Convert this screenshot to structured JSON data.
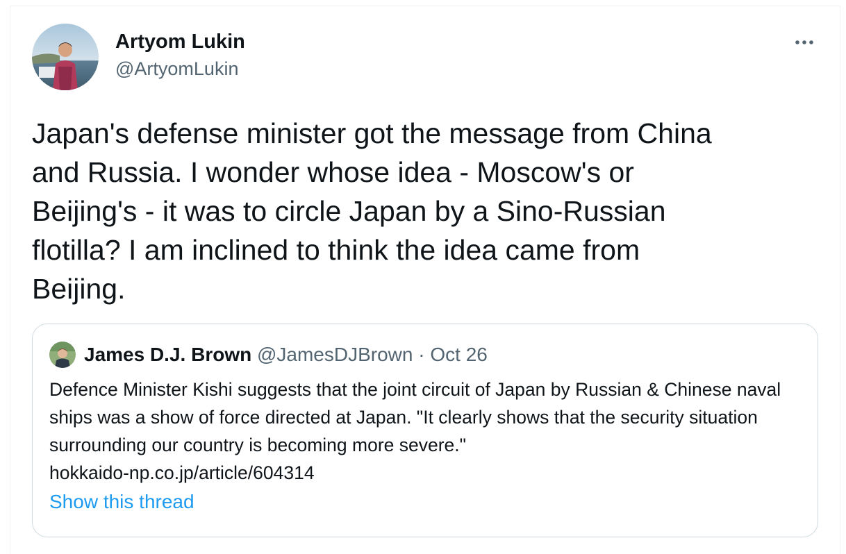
{
  "tweet": {
    "author_name": "Artyom Lukin",
    "author_handle": "@ArtyomLukin",
    "text": "Japan's defense minister got the message from China\nand Russia. I wonder whose idea - Moscow's or\nBeijing's - it was to circle Japan by a Sino-Russian\nflotilla? I am inclined to think the idea came from\nBeijing.",
    "more_icon": "more-horizontal-icon",
    "avatar_icon": "user-photo-avatar"
  },
  "quoted_tweet": {
    "author_name": "James D.J. Brown",
    "author_handle": "@JamesDJBrown",
    "separator": "·",
    "date": "Oct 26",
    "text": "Defence Minister Kishi suggests that the joint circuit of Japan by Russian & Chinese naval ships was a show of force directed at Japan. \"It clearly shows that the security situation surrounding our country is becoming more severe.\"",
    "link": "hokkaido-np.co.jp/article/604314",
    "show_thread_label": "Show this thread",
    "avatar_icon": "user-photo-avatar"
  },
  "colors": {
    "text_primary": "#0f1419",
    "text_secondary": "#536471",
    "link_blue": "#1d9bf0",
    "border": "#cfd9de"
  }
}
